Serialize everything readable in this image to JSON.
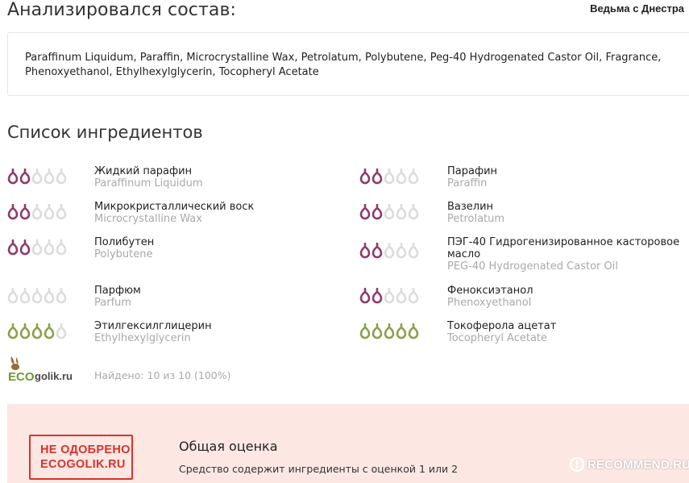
{
  "header": {
    "title": "Анализировался состав:",
    "author": "Ведьма с Днестра"
  },
  "composition": {
    "ingredients": [
      "Paraffinum Liquidum",
      "Paraffin",
      "Microcrystalline Wax",
      "Petrolatum",
      "Polybutene",
      "Peg-40 Hydrogenated Castor Oil",
      "Fragrance",
      "Phenoxyethanol",
      "Ethylhexylglycerin",
      "Tocopheryl Acetate"
    ],
    "separator": ","
  },
  "ingredients_section": {
    "title": "Список ингредиентов",
    "items": [
      {
        "ru": "Жидкий парафин",
        "en": "Paraffinum Liquidum",
        "rating": 2,
        "color": "#8e3a6e"
      },
      {
        "ru": "Парафин",
        "en": "Paraffin",
        "rating": 2,
        "color": "#8e3a6e"
      },
      {
        "ru": "Микрокристаллический воск",
        "en": "Microcrystalline Wax",
        "rating": 2,
        "color": "#8e3a6e"
      },
      {
        "ru": "Вазелин",
        "en": "Petrolatum",
        "rating": 2,
        "color": "#8e3a6e"
      },
      {
        "ru": "Полибутен",
        "en": "Polybutene",
        "rating": 2,
        "color": "#8e3a6e"
      },
      {
        "ru": "ПЭГ-40 Гидрогенизированное касторовое масло",
        "en": "PEG-40 Hydrogenated Castor Oil",
        "rating": 2,
        "color": "#8e3a6e"
      },
      {
        "ru": "Парфюм",
        "en": "Parfum",
        "rating": 0,
        "color": "#cccccc"
      },
      {
        "ru": "Феноксиэтанол",
        "en": "Phenoxyethanol",
        "rating": 2,
        "color": "#8e3a6e"
      },
      {
        "ru": "Этилгексилглицерин",
        "en": "Ethylhexylglycerin",
        "rating": 4,
        "color": "#8aa04a"
      },
      {
        "ru": "Токоферола ацетат",
        "en": "Tocopheryl Acetate",
        "rating": 5,
        "color": "#8aa04a"
      }
    ]
  },
  "logo": {
    "text_eco": "ECO",
    "text_golik": "golik.ru"
  },
  "found": "Найдено: 10 из 10 (100%)",
  "verdict": {
    "stamp_line1": "НЕ ОДОБРЕНО",
    "stamp_line2": "ECOGOLIK.RU",
    "title": "Общая оценка",
    "description": "Средство содержит ингредиенты с оценкой 1 или 2"
  },
  "watermark": {
    "text": "RECOMMEND.RU"
  },
  "colors": {
    "bad": "#8e3a6e",
    "good": "#8aa04a",
    "empty": "#dcdcdc",
    "stamp": "#d9322b",
    "verdict_bg": "#fce7e3"
  }
}
